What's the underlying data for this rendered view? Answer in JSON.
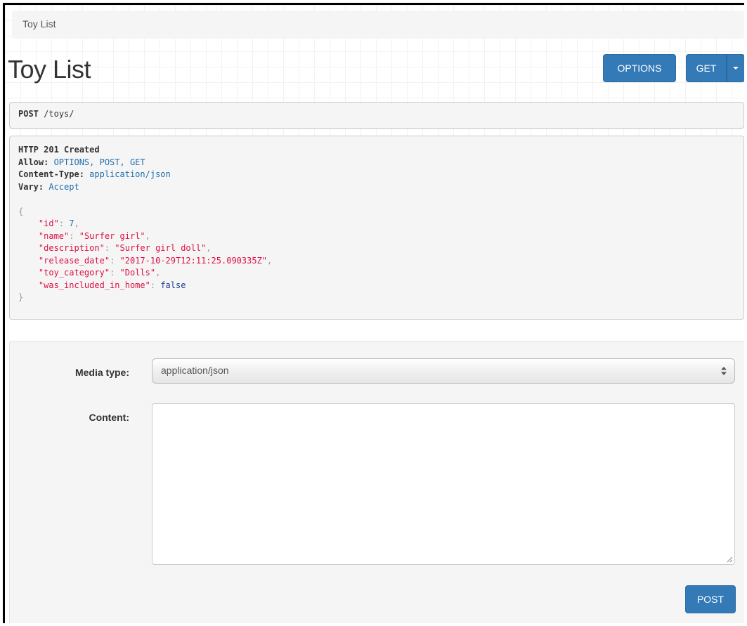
{
  "breadcrumb": {
    "items": [
      "Toy List"
    ]
  },
  "page": {
    "title": "Toy List"
  },
  "header_buttons": {
    "options_label": "OPTIONS",
    "get_label": "GET"
  },
  "request": {
    "method": "POST",
    "path": "/toys/"
  },
  "response": {
    "status": "HTTP 201 Created",
    "headers": [
      {
        "key": "Allow",
        "value": "OPTIONS, POST, GET"
      },
      {
        "key": "Content-Type",
        "value": "application/json"
      },
      {
        "key": "Vary",
        "value": "Accept"
      }
    ],
    "body": {
      "open": "{",
      "close": "}",
      "fields": [
        {
          "key": "\"id\"",
          "value": "7",
          "kind": "num",
          "comma": ","
        },
        {
          "key": "\"name\"",
          "value": "\"Surfer girl\"",
          "kind": "str",
          "comma": ","
        },
        {
          "key": "\"description\"",
          "value": "\"Surfer girl doll\"",
          "kind": "str",
          "comma": ","
        },
        {
          "key": "\"release_date\"",
          "value": "\"2017-10-29T12:11:25.090335Z\"",
          "kind": "str",
          "comma": ","
        },
        {
          "key": "\"toy_category\"",
          "value": "\"Dolls\"",
          "kind": "str",
          "comma": ","
        },
        {
          "key": "\"was_included_in_home\"",
          "value": "false",
          "kind": "lit",
          "comma": ""
        }
      ]
    }
  },
  "form": {
    "media_type_label": "Media type:",
    "media_type_value": "application/json",
    "content_label": "Content:",
    "content_value": "",
    "post_label": "POST"
  },
  "colors": {
    "primary": "#337ab7",
    "string": "#dd1144",
    "number": "#1f6fae"
  }
}
